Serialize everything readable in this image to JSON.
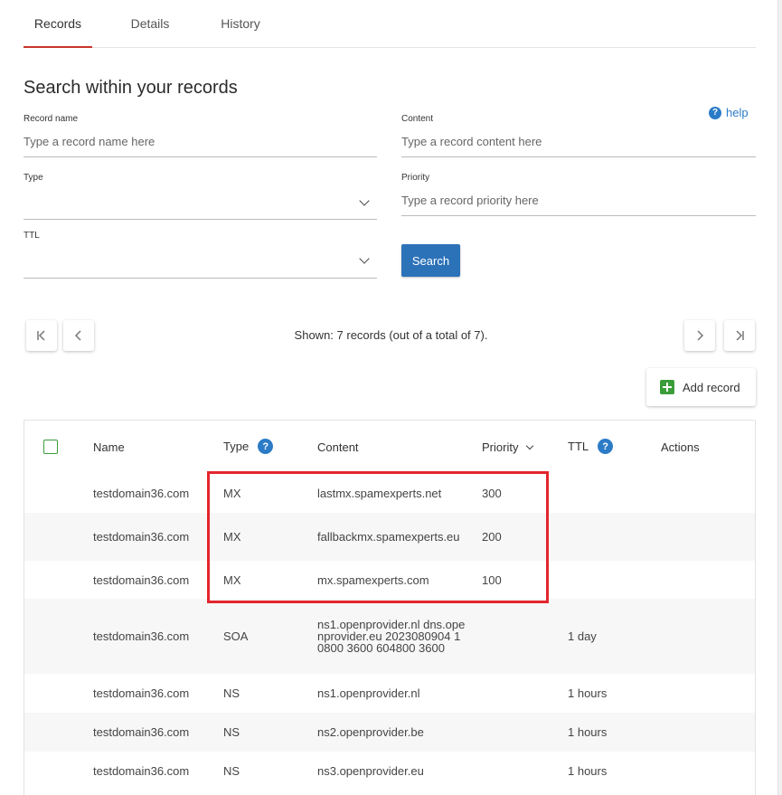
{
  "tabs": [
    {
      "label": "Records",
      "active": true
    },
    {
      "label": "Details",
      "active": false
    },
    {
      "label": "History",
      "active": false
    }
  ],
  "search": {
    "title": "Search within your records",
    "help": "help",
    "record_name": {
      "label": "Record name",
      "placeholder": "Type a record name here"
    },
    "content": {
      "label": "Content",
      "placeholder": "Type a record content here"
    },
    "type": {
      "label": "Type",
      "value": ""
    },
    "priority": {
      "label": "Priority",
      "placeholder": "Type a record priority here"
    },
    "ttl": {
      "label": "TTL",
      "value": ""
    },
    "button": "Search"
  },
  "pagination": {
    "shown_text": "Shown: 7 records (out of a total of 7)."
  },
  "add_record": "Add record",
  "table": {
    "headers": {
      "name": "Name",
      "type": "Type",
      "content": "Content",
      "priority": "Priority",
      "ttl": "TTL",
      "actions": "Actions"
    },
    "rows": [
      {
        "name": "testdomain36.com",
        "type": "MX",
        "content": "lastmx.spamexperts.net",
        "priority": "300",
        "ttl": ""
      },
      {
        "name": "testdomain36.com",
        "type": "MX",
        "content": "fallbackmx.spamexperts.eu",
        "priority": "200",
        "ttl": ""
      },
      {
        "name": "testdomain36.com",
        "type": "MX",
        "content": "mx.spamexperts.com",
        "priority": "100",
        "ttl": ""
      },
      {
        "name": "testdomain36.com",
        "type": "SOA",
        "content": "ns1.openprovider.nl dns.openprovider.eu 2023080904 10800 3600 604800 3600",
        "priority": "",
        "ttl": "1 day"
      },
      {
        "name": "testdomain36.com",
        "type": "NS",
        "content": "ns1.openprovider.nl",
        "priority": "",
        "ttl": "1 hours"
      },
      {
        "name": "testdomain36.com",
        "type": "NS",
        "content": "ns2.openprovider.be",
        "priority": "",
        "ttl": "1 hours"
      },
      {
        "name": "testdomain36.com",
        "type": "NS",
        "content": "ns3.openprovider.eu",
        "priority": "",
        "ttl": "1 hours"
      }
    ]
  },
  "colors": {
    "accent": "#c8352b",
    "primary": "#2c72b8",
    "success": "#3a9d3a",
    "highlight": "#e3262e"
  }
}
